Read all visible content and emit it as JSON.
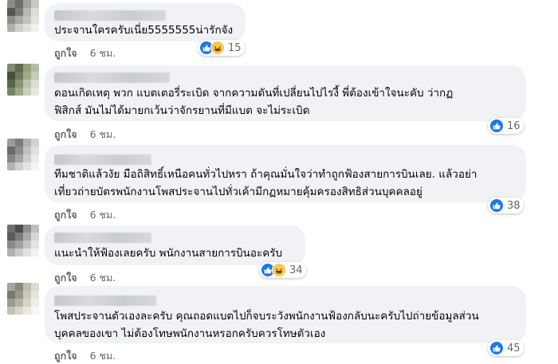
{
  "comments": [
    {
      "text": "ประจานใครครับเนี่ย5555555น่ารักจัง",
      "like_label": "ถูกใจ",
      "time": "6 ชม.",
      "reaction_count": "15",
      "reactions": [
        "like",
        "haha"
      ]
    },
    {
      "text": "ดอนเกิดเหตุ พวก แบตเตอรี่ระเบิด จากความดันที่เปลี่ยนไปไรงี้ พี่ต้องเข้าใจนะคับ ว่ากฏ\nฟิสิกส์ มันไม่ได้มายกเว้นว่าจักรยานที่มีแบต จะไม่ระเบิด",
      "like_label": "ถูกใจ",
      "time": "6 ชม.",
      "reaction_count": "16",
      "reactions": [
        "like"
      ]
    },
    {
      "text": "ทีมชาติแล้วงัย มือถิสิทธิ์เหนือคนทั่วไปหรา ถ้าคุณมั่นใจว่าทำถูกฟ้องสายการบินเลย. แล้วอย่า\nเที่ยวถ่ายบัตรพนักงานโพสประจานไปทั่วเค้ามีกฏหมายคุ้มครองสิทธิส่วนบุคคลอยู่",
      "like_label": "ถูกใจ",
      "time": "6 ชม.",
      "reaction_count": "38",
      "reactions": [
        "like"
      ]
    },
    {
      "text": "แนะนำให้ฟ้องเลยครับ พนักงานสายการบินอะครับ",
      "like_label": "ถูกใจ",
      "time": "6 ชม.",
      "reaction_count": "34",
      "reactions": [
        "like",
        "haha"
      ]
    },
    {
      "text": "โพสประจานตัวเองละครับ คุณถอดแบตไปก็จบระวังพนักงานฟ้องกลับนะครับไปถ่ายข้อมูลส่วน\nบุคคลของเขา ไม่ต้องโทษพนักงานหรอกครับควรโทษตัวเอง",
      "like_label": "ถูกใจ",
      "time": "6 ชม.",
      "reaction_count": "45",
      "reactions": [
        "like"
      ]
    }
  ],
  "colors": {
    "bubble": "#f0f2f5",
    "like_blue": "#1877f2",
    "haha_yellow": "#f7c948",
    "meta_gray": "#65676b"
  }
}
